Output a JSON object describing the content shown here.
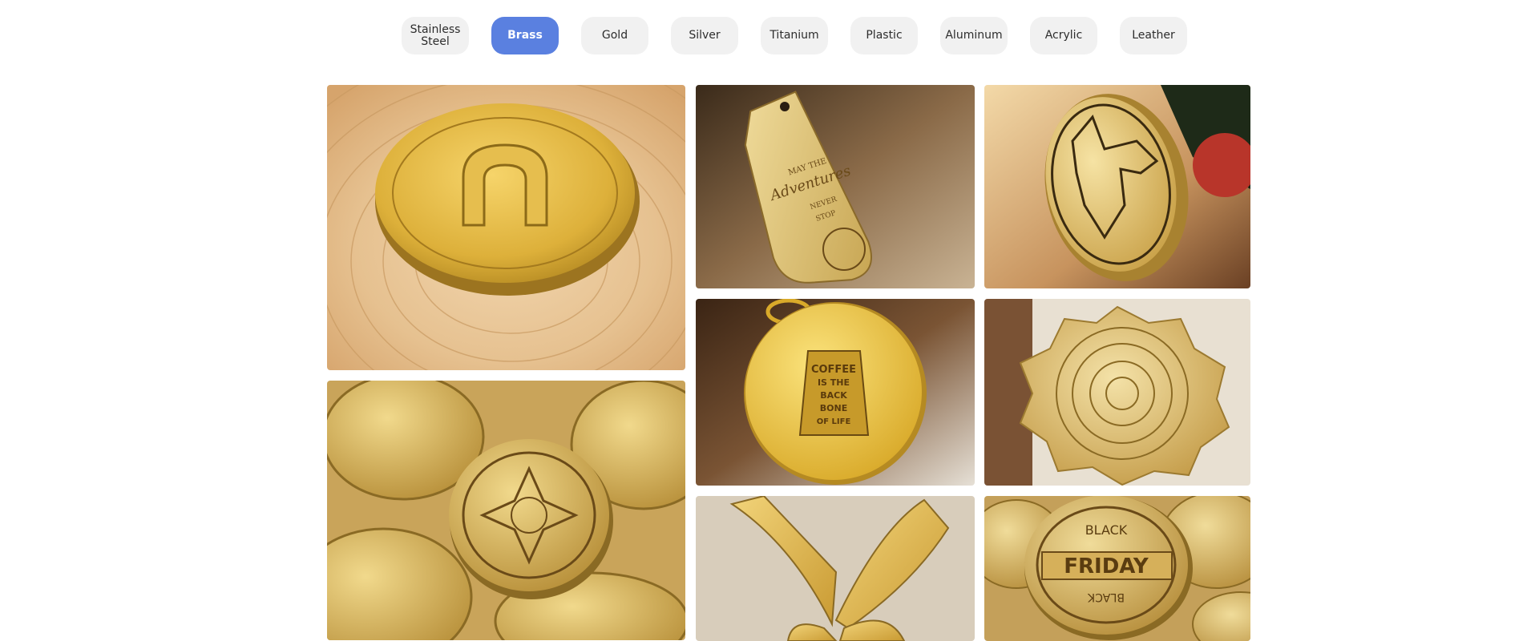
{
  "tabs": [
    {
      "label": "Stainless Steel",
      "active": false
    },
    {
      "label": "Brass",
      "active": true
    },
    {
      "label": "Gold",
      "active": false
    },
    {
      "label": "Silver",
      "active": false
    },
    {
      "label": "Titanium",
      "active": false
    },
    {
      "label": "Plastic",
      "active": false
    },
    {
      "label": "Aluminum",
      "active": false
    },
    {
      "label": "Acrylic",
      "active": false
    },
    {
      "label": "Leather",
      "active": false
    }
  ],
  "colors": {
    "active_tab": "#5a80e0",
    "inactive_tab": "#f1f1f1",
    "brass": "#d9b24a",
    "brass_dark": "#a9822a",
    "wood": "#e8c89c"
  },
  "gallery": {
    "items": [
      {
        "subject": "horseshoe-coin-on-wood"
      },
      {
        "subject": "adventure-keytag",
        "text_lines": [
          "MAY THE",
          "Adventures",
          "NEVER",
          "STOP"
        ]
      },
      {
        "subject": "wolf-oval-tag"
      },
      {
        "subject": "brass-coin-pile"
      },
      {
        "subject": "coffee-pendant",
        "text_lines": [
          "COFFEE",
          "IS THE",
          "BACK",
          "BONE",
          "OF LIFE"
        ]
      },
      {
        "subject": "mandala-brass-tag"
      },
      {
        "subject": "butterfly-brass-cutout"
      },
      {
        "subject": "black-friday-coins",
        "text_lines": [
          "BLACK",
          "FRIDAY",
          "BLACK"
        ]
      }
    ]
  }
}
